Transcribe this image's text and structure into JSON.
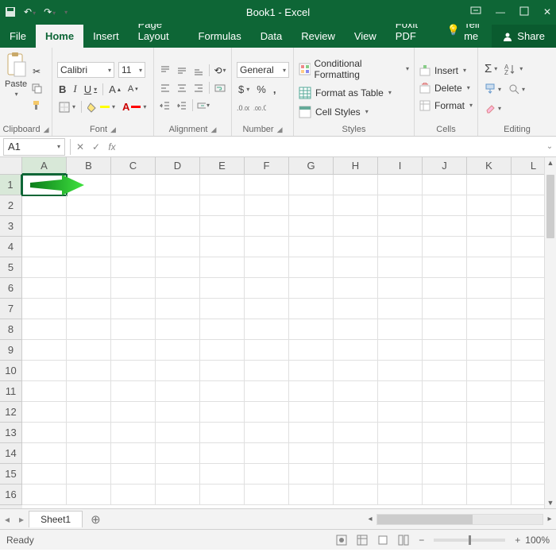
{
  "title": "Book1 - Excel",
  "tabs": {
    "file": "File",
    "home": "Home",
    "insert": "Insert",
    "pagelayout": "Page Layout",
    "formulas": "Formulas",
    "data": "Data",
    "review": "Review",
    "view": "View",
    "foxit": "Foxit PDF",
    "tellme": "Tell me",
    "share": "Share"
  },
  "ribbon": {
    "clipboard": {
      "paste": "Paste",
      "title": "Clipboard"
    },
    "font": {
      "name": "Calibri",
      "size": "11",
      "bold": "B",
      "italic": "I",
      "underline": "U",
      "title": "Font"
    },
    "alignment": {
      "title": "Alignment"
    },
    "number": {
      "format": "General",
      "currency": "$",
      "percent": "%",
      "comma": ",",
      "title": "Number"
    },
    "styles": {
      "cond": "Conditional Formatting",
      "table": "Format as Table",
      "cell": "Cell Styles",
      "title": "Styles"
    },
    "cells": {
      "insert": "Insert",
      "delete": "Delete",
      "format": "Format",
      "title": "Cells"
    },
    "editing": {
      "title": "Editing"
    }
  },
  "namebox": "A1",
  "fx_label": "fx",
  "columns": [
    "A",
    "B",
    "C",
    "D",
    "E",
    "F",
    "G",
    "H",
    "I",
    "J",
    "K",
    "L"
  ],
  "rows": [
    "1",
    "2",
    "3",
    "4",
    "5",
    "6",
    "7",
    "8",
    "9",
    "10",
    "11",
    "12",
    "13",
    "14",
    "15",
    "16"
  ],
  "sheet_tab": "Sheet1",
  "status": {
    "ready": "Ready",
    "zoom": "100%"
  }
}
